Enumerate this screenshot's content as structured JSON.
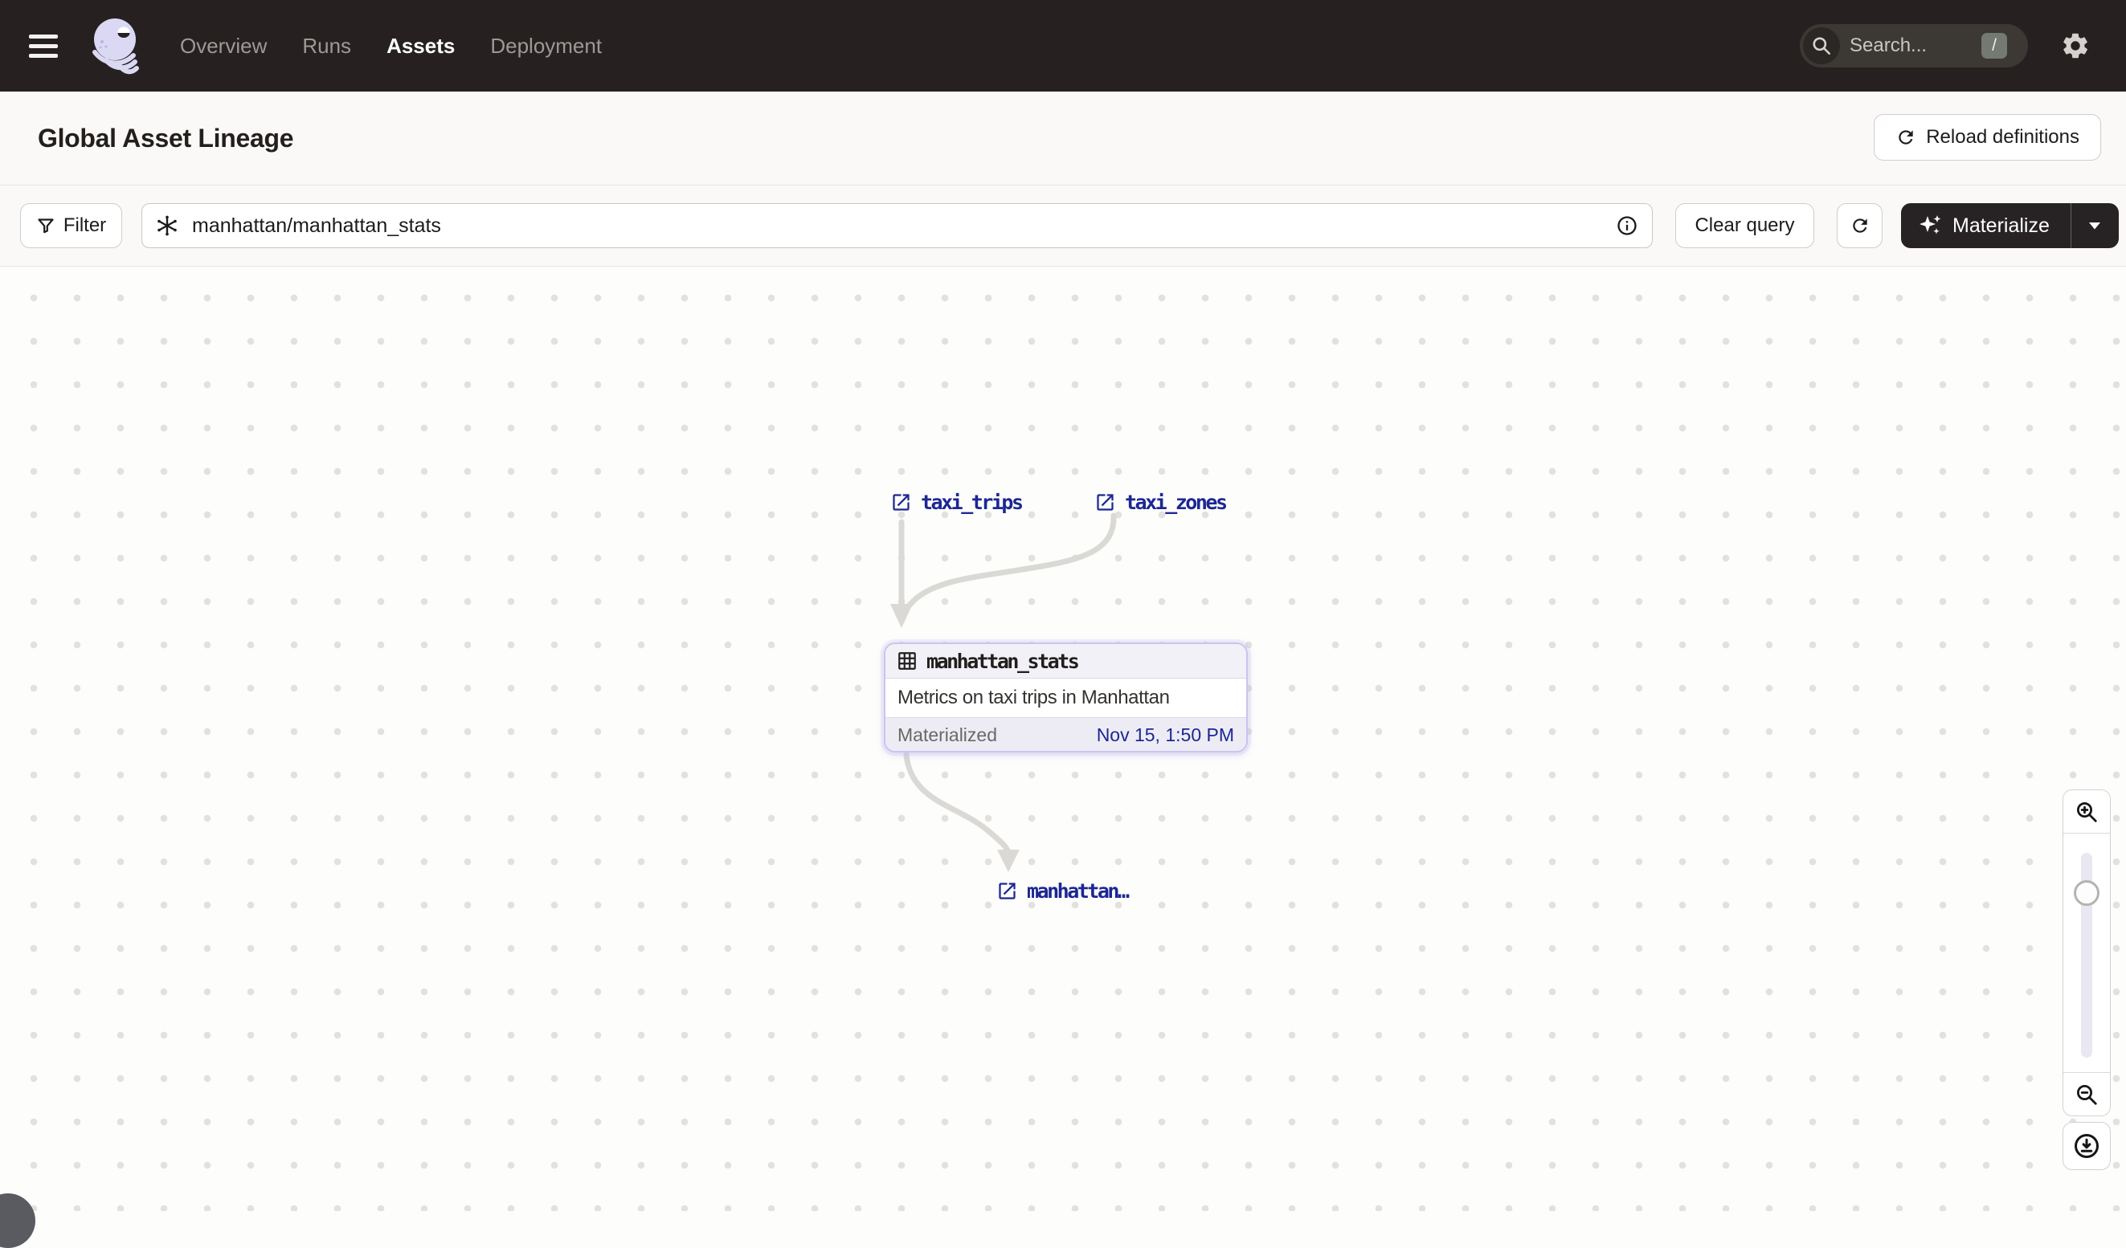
{
  "nav": {
    "items": [
      {
        "label": "Overview",
        "active": false
      },
      {
        "label": "Runs",
        "active": false
      },
      {
        "label": "Assets",
        "active": true
      },
      {
        "label": "Deployment",
        "active": false
      }
    ],
    "search": {
      "placeholder": "Search...",
      "shortcut": "/"
    }
  },
  "header": {
    "title": "Global Asset Lineage",
    "reload_button_label": "Reload definitions"
  },
  "toolbar": {
    "filter_label": "Filter",
    "query_value": "manhattan/manhattan_stats",
    "clear_query_label": "Clear query",
    "materialize_label": "Materialize"
  },
  "graph": {
    "upstream_nodes": [
      {
        "label": "taxi_trips"
      },
      {
        "label": "taxi_zones"
      }
    ],
    "selected_asset": {
      "name": "manhattan_stats",
      "description": "Metrics on taxi trips in Manhattan",
      "status_label": "Materialized",
      "materialized_at": "Nov 15, 1:50 PM"
    },
    "downstream_nodes": [
      {
        "label": "manhattan…"
      }
    ]
  },
  "colors": {
    "navbar_bg": "#262120",
    "accent_navy": "#1c2793",
    "selection_border": "#c9c4ef",
    "edge_gray": "#dbd9d6",
    "materialize_bg": "#272324"
  }
}
